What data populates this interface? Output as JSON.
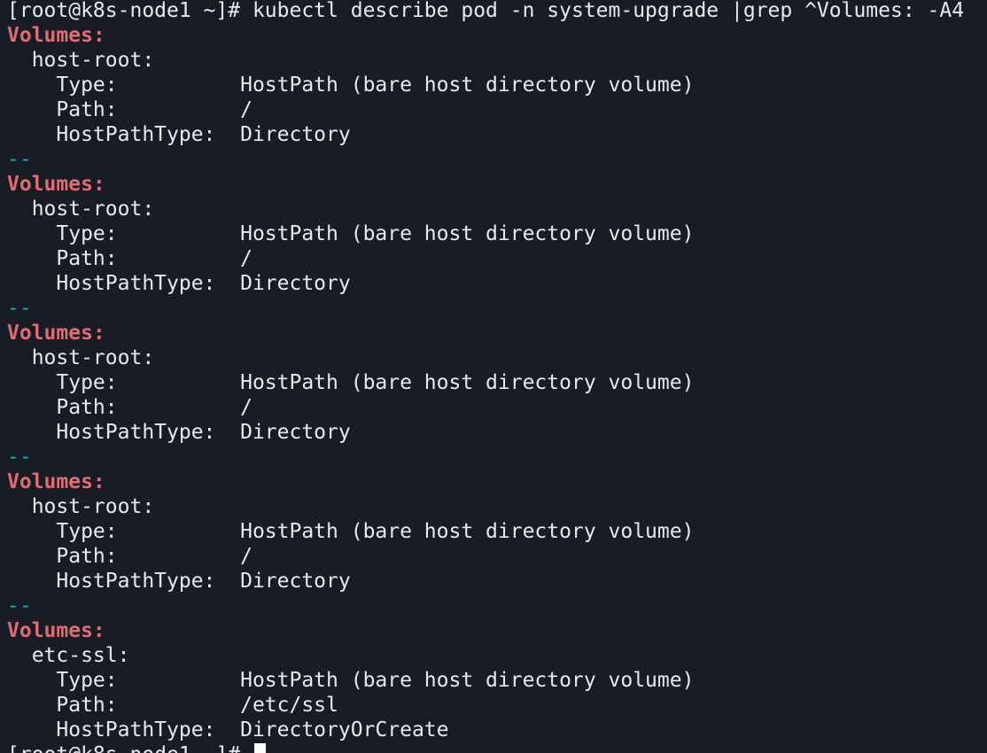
{
  "terminal": {
    "colors": {
      "background": "#181c25",
      "text": "#e6e9ee",
      "grep_match": "#e06c75",
      "separator": "#2aa6b8",
      "cursor": "#ffffff"
    },
    "lines": [
      [
        {
          "t": "[root@k8s-node1 ~]# kubectl describe pod -n system-upgrade |grep ^Volumes: -A4",
          "c": "plain"
        }
      ],
      [
        {
          "t": "Volumes:",
          "c": "match"
        }
      ],
      [
        {
          "t": "  host-root:",
          "c": "plain"
        }
      ],
      [
        {
          "t": "    Type:          HostPath (bare host directory volume)",
          "c": "plain"
        }
      ],
      [
        {
          "t": "    Path:          /",
          "c": "plain"
        }
      ],
      [
        {
          "t": "    HostPathType:  Directory",
          "c": "plain"
        }
      ],
      [
        {
          "t": "--",
          "c": "sep"
        }
      ],
      [
        {
          "t": "Volumes:",
          "c": "match"
        }
      ],
      [
        {
          "t": "  host-root:",
          "c": "plain"
        }
      ],
      [
        {
          "t": "    Type:          HostPath (bare host directory volume)",
          "c": "plain"
        }
      ],
      [
        {
          "t": "    Path:          /",
          "c": "plain"
        }
      ],
      [
        {
          "t": "    HostPathType:  Directory",
          "c": "plain"
        }
      ],
      [
        {
          "t": "--",
          "c": "sep"
        }
      ],
      [
        {
          "t": "Volumes:",
          "c": "match"
        }
      ],
      [
        {
          "t": "  host-root:",
          "c": "plain"
        }
      ],
      [
        {
          "t": "    Type:          HostPath (bare host directory volume)",
          "c": "plain"
        }
      ],
      [
        {
          "t": "    Path:          /",
          "c": "plain"
        }
      ],
      [
        {
          "t": "    HostPathType:  Directory",
          "c": "plain"
        }
      ],
      [
        {
          "t": "--",
          "c": "sep"
        }
      ],
      [
        {
          "t": "Volumes:",
          "c": "match"
        }
      ],
      [
        {
          "t": "  host-root:",
          "c": "plain"
        }
      ],
      [
        {
          "t": "    Type:          HostPath (bare host directory volume)",
          "c": "plain"
        }
      ],
      [
        {
          "t": "    Path:          /",
          "c": "plain"
        }
      ],
      [
        {
          "t": "    HostPathType:  Directory",
          "c": "plain"
        }
      ],
      [
        {
          "t": "--",
          "c": "sep"
        }
      ],
      [
        {
          "t": "Volumes:",
          "c": "match"
        }
      ],
      [
        {
          "t": "  etc-ssl:",
          "c": "plain"
        }
      ],
      [
        {
          "t": "    Type:          HostPath (bare host directory volume)",
          "c": "plain"
        }
      ],
      [
        {
          "t": "    Path:          /etc/ssl",
          "c": "plain"
        }
      ],
      [
        {
          "t": "    HostPathType:  DirectoryOrCreate",
          "c": "plain"
        }
      ]
    ],
    "prompt": "[root@k8s-node1 ~]# "
  }
}
